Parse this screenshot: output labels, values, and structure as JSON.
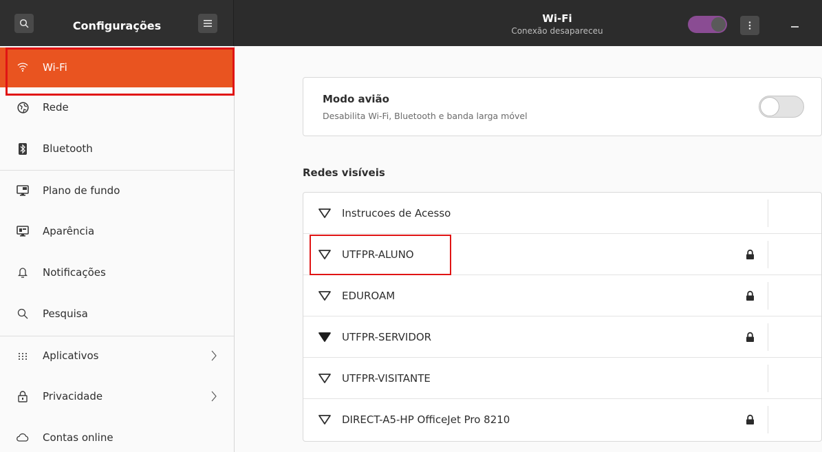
{
  "header": {
    "app_title": "Configurações",
    "page_title": "Wi-Fi",
    "page_subtitle": "Conexão desapareceu",
    "wifi_switch_on": true,
    "icons": [
      "search-icon",
      "hamburger-menu-icon",
      "kebab-menu-icon",
      "minimize-icon"
    ]
  },
  "sidebar": {
    "items": [
      {
        "label": "Wi-Fi",
        "icon": "wifi-icon",
        "active": true
      },
      {
        "label": "Rede",
        "icon": "network-icon"
      },
      {
        "label": "Bluetooth",
        "icon": "bluetooth-icon"
      },
      {
        "label": "Plano de fundo",
        "icon": "background-icon"
      },
      {
        "label": "Aparência",
        "icon": "appearance-icon"
      },
      {
        "label": "Notificações",
        "icon": "bell-icon"
      },
      {
        "label": "Pesquisa",
        "icon": "search-icon"
      },
      {
        "label": "Aplicativos",
        "icon": "apps-grid-icon",
        "has_submenu": true
      },
      {
        "label": "Privacidade",
        "icon": "lock-icon",
        "has_submenu": true
      },
      {
        "label": "Contas online",
        "icon": "cloud-icon"
      }
    ]
  },
  "airplane": {
    "title": "Modo avião",
    "subtitle": "Desabilita Wi-Fi, Bluetooth e banda larga móvel",
    "enabled": false
  },
  "networks": {
    "section_label": "Redes visíveis",
    "items": [
      {
        "name": "Instrucoes de Acesso",
        "secured": false,
        "signal": "weak"
      },
      {
        "name": "UTFPR-ALUNO",
        "secured": true,
        "signal": "weak"
      },
      {
        "name": "EDUROAM",
        "secured": true,
        "signal": "weak"
      },
      {
        "name": "UTFPR-SERVIDOR",
        "secured": true,
        "signal": "strong"
      },
      {
        "name": "UTFPR-VISITANTE",
        "secured": false,
        "signal": "weak"
      },
      {
        "name": "DIRECT-A5-HP OfficeJet Pro 8210",
        "secured": true,
        "signal": "weak"
      }
    ]
  },
  "colors": {
    "accent": "#e95420",
    "header_bg": "#2c2c2c",
    "switch_on": "#8a4c93",
    "highlight": "#e01414"
  }
}
